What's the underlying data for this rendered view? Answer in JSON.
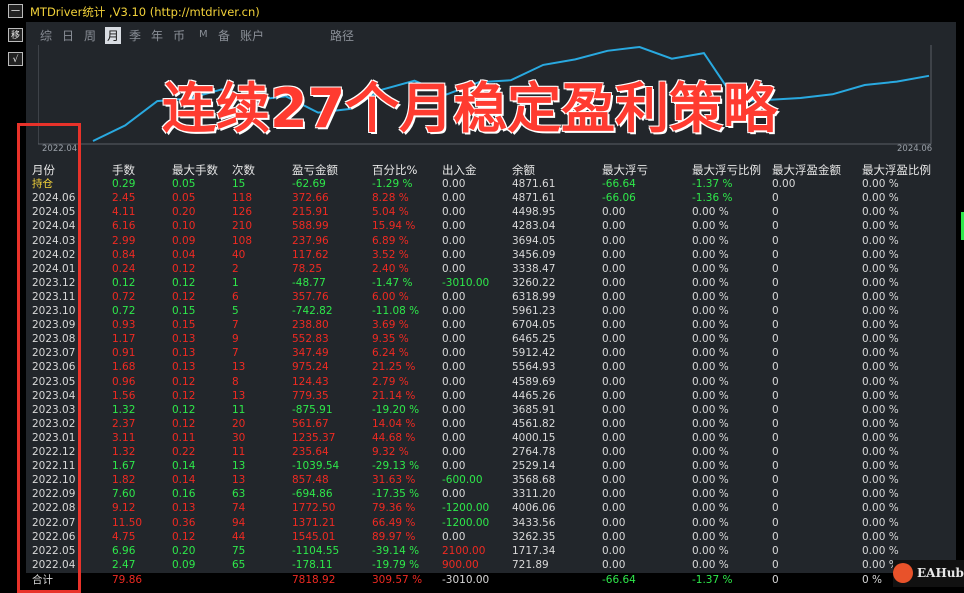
{
  "app": {
    "title": "MTDriver统计 ,V3.10 (http://mtdriver.cn)"
  },
  "left_buttons": [
    "一",
    "移",
    "√"
  ],
  "tabs": [
    {
      "label": "综",
      "active": false
    },
    {
      "label": "日",
      "active": false
    },
    {
      "label": "周",
      "active": false
    },
    {
      "label": "月",
      "active": true
    },
    {
      "label": "季",
      "active": false
    },
    {
      "label": "年",
      "active": false
    },
    {
      "label": "币",
      "active": false
    },
    {
      "label": "M",
      "active": false
    },
    {
      "label": "备",
      "active": false
    },
    {
      "label": "账户",
      "active": false
    },
    {
      "label": "路径",
      "active": false
    }
  ],
  "overlay_text": "连续27个月稳定盈利策略",
  "chart": {
    "start_label": "2022.04",
    "end_label": "2024.06",
    "line_color": "#29a9e0",
    "balance_series": [
      721.89,
      1717.34,
      3262.35,
      3433.56,
      4006.06,
      3311.2,
      3568.68,
      2529.14,
      2764.78,
      4000.15,
      4561.82,
      3685.91,
      4465.26,
      4589.69,
      5564.93,
      5912.42,
      6465.25,
      6704.05,
      5961.23,
      6318.99,
      3260.22,
      3338.47,
      3456.09,
      3694.05,
      4283.04,
      4498.95,
      4871.61
    ]
  },
  "table": {
    "headers": [
      "月份",
      "手数",
      "最大手数",
      "次数",
      "盈亏金额",
      "百分比%",
      "出入金",
      "余额",
      "最大浮亏",
      "最大浮亏比例",
      "最大浮盈金额",
      "最大浮盈比例"
    ],
    "rows": [
      {
        "c": [
          "持仓",
          "0.29",
          "0.05",
          "15",
          "-62.69",
          "-1.29 %",
          "0.00",
          "4871.61",
          "-66.64",
          "-1.37 %",
          "0.00",
          "0.00 %"
        ],
        "k": [
          "y",
          "g",
          "g",
          "g",
          "g",
          "g",
          "w",
          "w",
          "g",
          "g",
          "w",
          "w"
        ]
      },
      {
        "c": [
          "2024.06",
          "2.45",
          "0.05",
          "118",
          "372.66",
          "8.28 %",
          "0.00",
          "4871.61",
          "-66.06",
          "-1.36 %",
          "0",
          "0.00 %"
        ],
        "k": [
          "w",
          "r",
          "r",
          "r",
          "r",
          "r",
          "w",
          "w",
          "g",
          "g",
          "w",
          "w"
        ]
      },
      {
        "c": [
          "2024.05",
          "4.11",
          "0.20",
          "126",
          "215.91",
          "5.04 %",
          "0.00",
          "4498.95",
          "0.00",
          "0.00 %",
          "0",
          "0.00 %"
        ],
        "k": [
          "w",
          "r",
          "r",
          "r",
          "r",
          "r",
          "w",
          "w",
          "w",
          "w",
          "w",
          "w"
        ]
      },
      {
        "c": [
          "2024.04",
          "6.16",
          "0.10",
          "210",
          "588.99",
          "15.94 %",
          "0.00",
          "4283.04",
          "0.00",
          "0.00 %",
          "0",
          "0.00 %"
        ],
        "k": [
          "w",
          "r",
          "r",
          "r",
          "r",
          "r",
          "w",
          "w",
          "w",
          "w",
          "w",
          "w"
        ]
      },
      {
        "c": [
          "2024.03",
          "2.99",
          "0.09",
          "108",
          "237.96",
          "6.89 %",
          "0.00",
          "3694.05",
          "0.00",
          "0.00 %",
          "0",
          "0.00 %"
        ],
        "k": [
          "w",
          "r",
          "r",
          "r",
          "r",
          "r",
          "w",
          "w",
          "w",
          "w",
          "w",
          "w"
        ]
      },
      {
        "c": [
          "2024.02",
          "0.84",
          "0.04",
          "40",
          "117.62",
          "3.52 %",
          "0.00",
          "3456.09",
          "0.00",
          "0.00 %",
          "0",
          "0.00 %"
        ],
        "k": [
          "w",
          "r",
          "r",
          "r",
          "r",
          "r",
          "w",
          "w",
          "w",
          "w",
          "w",
          "w"
        ]
      },
      {
        "c": [
          "2024.01",
          "0.24",
          "0.12",
          "2",
          "78.25",
          "2.40 %",
          "0.00",
          "3338.47",
          "0.00",
          "0.00 %",
          "0",
          "0.00 %"
        ],
        "k": [
          "w",
          "r",
          "r",
          "r",
          "r",
          "r",
          "w",
          "w",
          "w",
          "w",
          "w",
          "w"
        ]
      },
      {
        "c": [
          "2023.12",
          "0.12",
          "0.12",
          "1",
          "-48.77",
          "-1.47 %",
          "-3010.00",
          "3260.22",
          "0.00",
          "0.00 %",
          "0",
          "0.00 %"
        ],
        "k": [
          "w",
          "g",
          "g",
          "g",
          "g",
          "g",
          "g",
          "w",
          "w",
          "w",
          "w",
          "w"
        ]
      },
      {
        "c": [
          "2023.11",
          "0.72",
          "0.12",
          "6",
          "357.76",
          "6.00 %",
          "0.00",
          "6318.99",
          "0.00",
          "0.00 %",
          "0",
          "0.00 %"
        ],
        "k": [
          "w",
          "r",
          "r",
          "r",
          "r",
          "r",
          "w",
          "w",
          "w",
          "w",
          "w",
          "w"
        ]
      },
      {
        "c": [
          "2023.10",
          "0.72",
          "0.15",
          "5",
          "-742.82",
          "-11.08 %",
          "0.00",
          "5961.23",
          "0.00",
          "0.00 %",
          "0",
          "0.00 %"
        ],
        "k": [
          "w",
          "g",
          "g",
          "g",
          "g",
          "g",
          "w",
          "w",
          "w",
          "w",
          "w",
          "w"
        ]
      },
      {
        "c": [
          "2023.09",
          "0.93",
          "0.15",
          "7",
          "238.80",
          "3.69 %",
          "0.00",
          "6704.05",
          "0.00",
          "0.00 %",
          "0",
          "0.00 %"
        ],
        "k": [
          "w",
          "r",
          "r",
          "r",
          "r",
          "r",
          "w",
          "w",
          "w",
          "w",
          "w",
          "w"
        ]
      },
      {
        "c": [
          "2023.08",
          "1.17",
          "0.13",
          "9",
          "552.83",
          "9.35 %",
          "0.00",
          "6465.25",
          "0.00",
          "0.00 %",
          "0",
          "0.00 %"
        ],
        "k": [
          "w",
          "r",
          "r",
          "r",
          "r",
          "r",
          "w",
          "w",
          "w",
          "w",
          "w",
          "w"
        ]
      },
      {
        "c": [
          "2023.07",
          "0.91",
          "0.13",
          "7",
          "347.49",
          "6.24 %",
          "0.00",
          "5912.42",
          "0.00",
          "0.00 %",
          "0",
          "0.00 %"
        ],
        "k": [
          "w",
          "r",
          "r",
          "r",
          "r",
          "r",
          "w",
          "w",
          "w",
          "w",
          "w",
          "w"
        ]
      },
      {
        "c": [
          "2023.06",
          "1.68",
          "0.13",
          "13",
          "975.24",
          "21.25 %",
          "0.00",
          "5564.93",
          "0.00",
          "0.00 %",
          "0",
          "0.00 %"
        ],
        "k": [
          "w",
          "r",
          "r",
          "r",
          "r",
          "r",
          "w",
          "w",
          "w",
          "w",
          "w",
          "w"
        ]
      },
      {
        "c": [
          "2023.05",
          "0.96",
          "0.12",
          "8",
          "124.43",
          "2.79 %",
          "0.00",
          "4589.69",
          "0.00",
          "0.00 %",
          "0",
          "0.00 %"
        ],
        "k": [
          "w",
          "r",
          "r",
          "r",
          "r",
          "r",
          "w",
          "w",
          "w",
          "w",
          "w",
          "w"
        ]
      },
      {
        "c": [
          "2023.04",
          "1.56",
          "0.12",
          "13",
          "779.35",
          "21.14 %",
          "0.00",
          "4465.26",
          "0.00",
          "0.00 %",
          "0",
          "0.00 %"
        ],
        "k": [
          "w",
          "r",
          "r",
          "r",
          "r",
          "r",
          "w",
          "w",
          "w",
          "w",
          "w",
          "w"
        ]
      },
      {
        "c": [
          "2023.03",
          "1.32",
          "0.12",
          "11",
          "-875.91",
          "-19.20 %",
          "0.00",
          "3685.91",
          "0.00",
          "0.00 %",
          "0",
          "0.00 %"
        ],
        "k": [
          "w",
          "g",
          "g",
          "g",
          "g",
          "g",
          "w",
          "w",
          "w",
          "w",
          "w",
          "w"
        ]
      },
      {
        "c": [
          "2023.02",
          "2.37",
          "0.12",
          "20",
          "561.67",
          "14.04 %",
          "0.00",
          "4561.82",
          "0.00",
          "0.00 %",
          "0",
          "0.00 %"
        ],
        "k": [
          "w",
          "r",
          "r",
          "r",
          "r",
          "r",
          "w",
          "w",
          "w",
          "w",
          "w",
          "w"
        ]
      },
      {
        "c": [
          "2023.01",
          "3.11",
          "0.11",
          "30",
          "1235.37",
          "44.68 %",
          "0.00",
          "4000.15",
          "0.00",
          "0.00 %",
          "0",
          "0.00 %"
        ],
        "k": [
          "w",
          "r",
          "r",
          "r",
          "r",
          "r",
          "w",
          "w",
          "w",
          "w",
          "w",
          "w"
        ]
      },
      {
        "c": [
          "2022.12",
          "1.32",
          "0.22",
          "11",
          "235.64",
          "9.32 %",
          "0.00",
          "2764.78",
          "0.00",
          "0.00 %",
          "0",
          "0.00 %"
        ],
        "k": [
          "w",
          "r",
          "r",
          "r",
          "r",
          "r",
          "w",
          "w",
          "w",
          "w",
          "w",
          "w"
        ]
      },
      {
        "c": [
          "2022.11",
          "1.67",
          "0.14",
          "13",
          "-1039.54",
          "-29.13 %",
          "0.00",
          "2529.14",
          "0.00",
          "0.00 %",
          "0",
          "0.00 %"
        ],
        "k": [
          "w",
          "g",
          "g",
          "g",
          "g",
          "g",
          "w",
          "w",
          "w",
          "w",
          "w",
          "w"
        ]
      },
      {
        "c": [
          "2022.10",
          "1.82",
          "0.14",
          "13",
          "857.48",
          "31.63 %",
          "-600.00",
          "3568.68",
          "0.00",
          "0.00 %",
          "0",
          "0.00 %"
        ],
        "k": [
          "w",
          "r",
          "r",
          "r",
          "r",
          "r",
          "g",
          "w",
          "w",
          "w",
          "w",
          "w"
        ]
      },
      {
        "c": [
          "2022.09",
          "7.60",
          "0.16",
          "63",
          "-694.86",
          "-17.35 %",
          "0.00",
          "3311.20",
          "0.00",
          "0.00 %",
          "0",
          "0.00 %"
        ],
        "k": [
          "w",
          "g",
          "g",
          "g",
          "g",
          "g",
          "w",
          "w",
          "w",
          "w",
          "w",
          "w"
        ]
      },
      {
        "c": [
          "2022.08",
          "9.12",
          "0.13",
          "74",
          "1772.50",
          "79.36 %",
          "-1200.00",
          "4006.06",
          "0.00",
          "0.00 %",
          "0",
          "0.00 %"
        ],
        "k": [
          "w",
          "r",
          "r",
          "r",
          "r",
          "r",
          "g",
          "w",
          "w",
          "w",
          "w",
          "w"
        ]
      },
      {
        "c": [
          "2022.07",
          "11.50",
          "0.36",
          "94",
          "1371.21",
          "66.49 %",
          "-1200.00",
          "3433.56",
          "0.00",
          "0.00 %",
          "0",
          "0.00 %"
        ],
        "k": [
          "w",
          "r",
          "r",
          "r",
          "r",
          "r",
          "g",
          "w",
          "w",
          "w",
          "w",
          "w"
        ]
      },
      {
        "c": [
          "2022.06",
          "4.75",
          "0.12",
          "44",
          "1545.01",
          "89.97 %",
          "0.00",
          "3262.35",
          "0.00",
          "0.00 %",
          "0",
          "0.00 %"
        ],
        "k": [
          "w",
          "r",
          "r",
          "r",
          "r",
          "r",
          "w",
          "w",
          "w",
          "w",
          "w",
          "w"
        ]
      },
      {
        "c": [
          "2022.05",
          "6.96",
          "0.20",
          "75",
          "-1104.55",
          "-39.14 %",
          "2100.00",
          "1717.34",
          "0.00",
          "0.00 %",
          "0",
          "0.00 %"
        ],
        "k": [
          "w",
          "g",
          "g",
          "g",
          "g",
          "g",
          "r",
          "w",
          "w",
          "w",
          "w",
          "w"
        ]
      },
      {
        "c": [
          "2022.04",
          "2.47",
          "0.09",
          "65",
          "-178.11",
          "-19.79 %",
          "900.00",
          "721.89",
          "0.00",
          "0.00 %",
          "0",
          "0.00 %"
        ],
        "k": [
          "w",
          "g",
          "g",
          "g",
          "g",
          "g",
          "r",
          "w",
          "w",
          "w",
          "w",
          "w"
        ]
      }
    ],
    "total": {
      "c": [
        "合计",
        "79.86",
        "",
        "",
        "7818.92",
        "309.57 %",
        "-3010.00",
        "",
        "-66.64",
        "-1.37 %",
        "0",
        "0 %"
      ],
      "k": [
        "w",
        "r",
        "w",
        "w",
        "r",
        "r",
        "w",
        "w",
        "g",
        "g",
        "w",
        "w"
      ]
    }
  },
  "watermark": "EAHub",
  "colors": {
    "red": "#ee2a22",
    "green": "#2ee84a",
    "yellow": "#f2d23a",
    "white": "#d8d8d8",
    "highlight_box": "#e8322a"
  }
}
